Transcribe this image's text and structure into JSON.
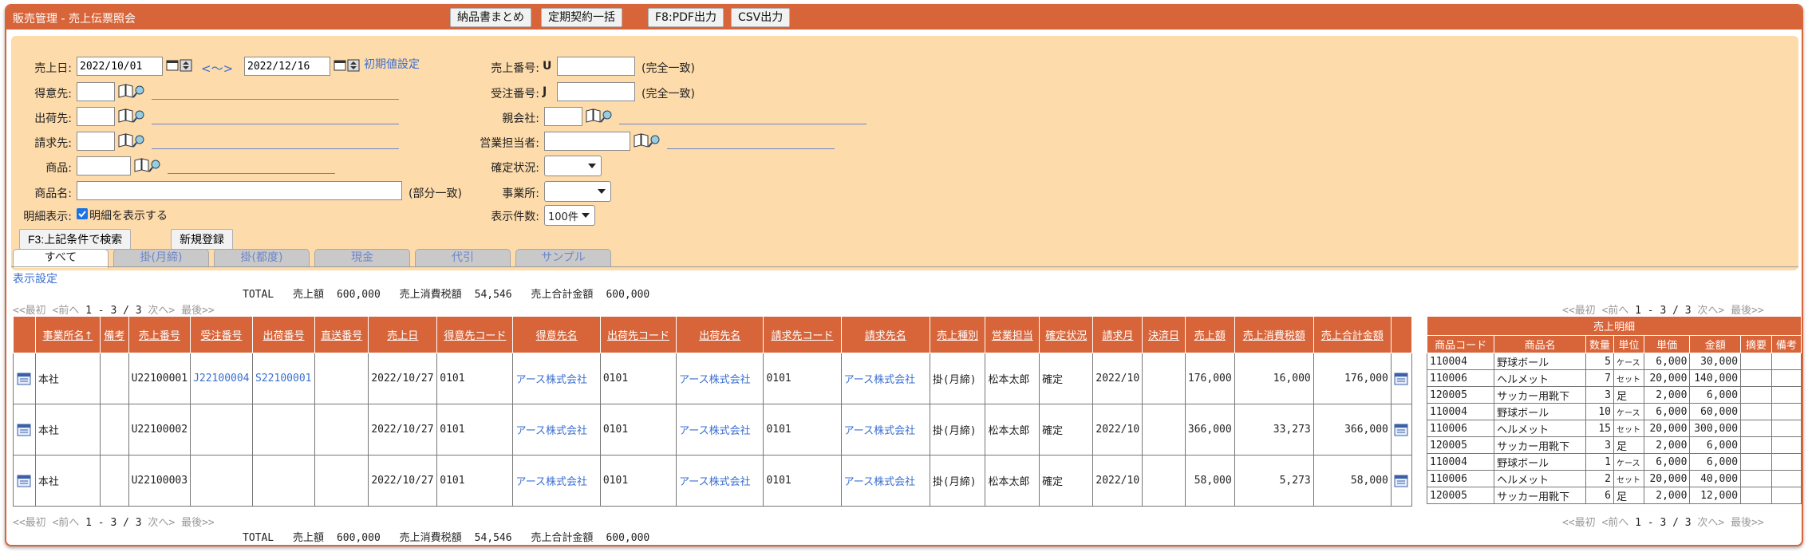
{
  "window": {
    "title": "販売管理 - 売上伝票照会",
    "toolbar": [
      "納品書まとめ",
      "定期契約一括",
      "F8:PDF出力",
      "CSV出力"
    ]
  },
  "search": {
    "sales_date_label": "売上日:",
    "date_from": "2022/10/01",
    "date_sep": "<～>",
    "date_to": "2022/12/16",
    "reset_label": "初期値設定",
    "customer_label": "得意先:",
    "ship_to_label": "出荷先:",
    "bill_to_label": "請求先:",
    "product_label": "商品:",
    "product_name_label": "商品名:",
    "partial_match": "(部分一致)",
    "detail_display_label": "明細表示:",
    "detail_checkbox_label": "明細を表示する",
    "sales_no_label": "売上番号:",
    "sales_no_prefix": "U",
    "order_no_label": "受注番号:",
    "order_no_prefix": "J",
    "exact_match": "(完全一致)",
    "parent_company_label": "親会社:",
    "sales_rep_label": "営業担当者:",
    "confirm_status_label": "確定状況:",
    "office_label": "事業所:",
    "page_size_label": "表示件数:",
    "page_size_value": "100件",
    "search_button": "F3:上記条件で検索",
    "new_button": "新規登録"
  },
  "tabs": [
    "すべて",
    "掛(月締)",
    "掛(都度)",
    "現金",
    "代引",
    "サンプル"
  ],
  "display_settings": "表示設定",
  "totals": {
    "label": "TOTAL",
    "sales_label": "売上額",
    "sales_value": "600,000",
    "tax_label": "売上消費税額",
    "tax_value": "54,546",
    "grand_label": "売上合計金額",
    "grand_value": "600,000"
  },
  "pager": {
    "first": "<<最初",
    "prev": "<前へ",
    "range": "1 - 3 / 3",
    "next": "次へ>",
    "last": "最後>>"
  },
  "table": {
    "columns": [
      "事業所名↑",
      "備考",
      "売上番号",
      "受注番号",
      "出荷番号",
      "直送番号",
      "売上日",
      "得意先コード",
      "得意先名",
      "出荷先コード",
      "出荷先名",
      "請求先コード",
      "請求先名",
      "売上種別",
      "営業担当",
      "確定状況",
      "請求月",
      "決済日",
      "売上額",
      "売上消費税額",
      "売上合計金額"
    ],
    "rows": [
      {
        "office": "本社",
        "note": "",
        "sales_no": "U22100001",
        "order_no": "J22100004",
        "ship_no": "S22100001",
        "direct_no": "",
        "date": "2022/10/27",
        "cust_code": "0101",
        "cust_name": "アース株式会社",
        "ship_code": "0101",
        "ship_name": "アース株式会社",
        "bill_code": "0101",
        "bill_name": "アース株式会社",
        "type": "掛(月締)",
        "rep": "松本太郎",
        "status": "確定",
        "bill_month": "2022/10",
        "settle_date": "",
        "amount": "176,000",
        "tax": "16,000",
        "total": "176,000",
        "details": [
          {
            "code": "110004",
            "name": "野球ボール",
            "qty": "5",
            "unit": "ケース",
            "price": "6,000",
            "amount": "30,000"
          },
          {
            "code": "110006",
            "name": "ヘルメット",
            "qty": "7",
            "unit": "セット",
            "price": "20,000",
            "amount": "140,000"
          },
          {
            "code": "120005",
            "name": "サッカー用靴下",
            "qty": "3",
            "unit": "足",
            "price": "2,000",
            "amount": "6,000"
          }
        ]
      },
      {
        "office": "本社",
        "note": "",
        "sales_no": "U22100002",
        "order_no": "",
        "ship_no": "",
        "direct_no": "",
        "date": "2022/10/27",
        "cust_code": "0101",
        "cust_name": "アース株式会社",
        "ship_code": "0101",
        "ship_name": "アース株式会社",
        "bill_code": "0101",
        "bill_name": "アース株式会社",
        "type": "掛(月締)",
        "rep": "松本太郎",
        "status": "確定",
        "bill_month": "2022/10",
        "settle_date": "",
        "amount": "366,000",
        "tax": "33,273",
        "total": "366,000",
        "details": [
          {
            "code": "110004",
            "name": "野球ボール",
            "qty": "10",
            "unit": "ケース",
            "price": "6,000",
            "amount": "60,000"
          },
          {
            "code": "110006",
            "name": "ヘルメット",
            "qty": "15",
            "unit": "セット",
            "price": "20,000",
            "amount": "300,000"
          },
          {
            "code": "120005",
            "name": "サッカー用靴下",
            "qty": "3",
            "unit": "足",
            "price": "2,000",
            "amount": "6,000"
          }
        ]
      },
      {
        "office": "本社",
        "note": "",
        "sales_no": "U22100003",
        "order_no": "",
        "ship_no": "",
        "direct_no": "",
        "date": "2022/10/27",
        "cust_code": "0101",
        "cust_name": "アース株式会社",
        "ship_code": "0101",
        "ship_name": "アース株式会社",
        "bill_code": "0101",
        "bill_name": "アース株式会社",
        "type": "掛(月締)",
        "rep": "松本太郎",
        "status": "確定",
        "bill_month": "2022/10",
        "settle_date": "",
        "amount": "58,000",
        "tax": "5,273",
        "total": "58,000",
        "details": [
          {
            "code": "110004",
            "name": "野球ボール",
            "qty": "1",
            "unit": "ケース",
            "price": "6,000",
            "amount": "6,000"
          },
          {
            "code": "110006",
            "name": "ヘルメット",
            "qty": "2",
            "unit": "セット",
            "price": "20,000",
            "amount": "40,000"
          },
          {
            "code": "120005",
            "name": "サッカー用靴下",
            "qty": "6",
            "unit": "足",
            "price": "2,000",
            "amount": "12,000"
          }
        ]
      }
    ]
  },
  "detail_table": {
    "title": "売上明細",
    "columns": [
      "商品コード",
      "商品名",
      "数量",
      "単位",
      "単価",
      "金額",
      "摘要",
      "備考"
    ]
  }
}
